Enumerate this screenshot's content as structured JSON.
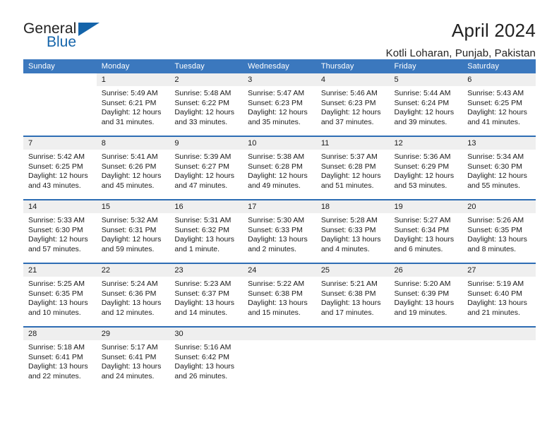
{
  "brand": {
    "line1": "General",
    "line2": "Blue",
    "mark": "triangle-icon"
  },
  "header": {
    "title": "April 2024",
    "subtitle": "Kotli Loharan, Punjab, Pakistan"
  },
  "colors": {
    "header_blue": "#3b78be",
    "row_rule_blue": "#2e6db4",
    "daynum_band": "#efefef",
    "brand_blue": "#1464aa",
    "text": "#1a1a1a"
  },
  "weekday_headers": [
    "Sunday",
    "Monday",
    "Tuesday",
    "Wednesday",
    "Thursday",
    "Friday",
    "Saturday"
  ],
  "weeks": [
    [
      {
        "day": "",
        "lines": []
      },
      {
        "day": "1",
        "lines": [
          "Sunrise: 5:49 AM",
          "Sunset: 6:21 PM",
          "Daylight: 12 hours",
          "and 31 minutes."
        ]
      },
      {
        "day": "2",
        "lines": [
          "Sunrise: 5:48 AM",
          "Sunset: 6:22 PM",
          "Daylight: 12 hours",
          "and 33 minutes."
        ]
      },
      {
        "day": "3",
        "lines": [
          "Sunrise: 5:47 AM",
          "Sunset: 6:23 PM",
          "Daylight: 12 hours",
          "and 35 minutes."
        ]
      },
      {
        "day": "4",
        "lines": [
          "Sunrise: 5:46 AM",
          "Sunset: 6:23 PM",
          "Daylight: 12 hours",
          "and 37 minutes."
        ]
      },
      {
        "day": "5",
        "lines": [
          "Sunrise: 5:44 AM",
          "Sunset: 6:24 PM",
          "Daylight: 12 hours",
          "and 39 minutes."
        ]
      },
      {
        "day": "6",
        "lines": [
          "Sunrise: 5:43 AM",
          "Sunset: 6:25 PM",
          "Daylight: 12 hours",
          "and 41 minutes."
        ]
      }
    ],
    [
      {
        "day": "7",
        "lines": [
          "Sunrise: 5:42 AM",
          "Sunset: 6:25 PM",
          "Daylight: 12 hours",
          "and 43 minutes."
        ]
      },
      {
        "day": "8",
        "lines": [
          "Sunrise: 5:41 AM",
          "Sunset: 6:26 PM",
          "Daylight: 12 hours",
          "and 45 minutes."
        ]
      },
      {
        "day": "9",
        "lines": [
          "Sunrise: 5:39 AM",
          "Sunset: 6:27 PM",
          "Daylight: 12 hours",
          "and 47 minutes."
        ]
      },
      {
        "day": "10",
        "lines": [
          "Sunrise: 5:38 AM",
          "Sunset: 6:28 PM",
          "Daylight: 12 hours",
          "and 49 minutes."
        ]
      },
      {
        "day": "11",
        "lines": [
          "Sunrise: 5:37 AM",
          "Sunset: 6:28 PM",
          "Daylight: 12 hours",
          "and 51 minutes."
        ]
      },
      {
        "day": "12",
        "lines": [
          "Sunrise: 5:36 AM",
          "Sunset: 6:29 PM",
          "Daylight: 12 hours",
          "and 53 minutes."
        ]
      },
      {
        "day": "13",
        "lines": [
          "Sunrise: 5:34 AM",
          "Sunset: 6:30 PM",
          "Daylight: 12 hours",
          "and 55 minutes."
        ]
      }
    ],
    [
      {
        "day": "14",
        "lines": [
          "Sunrise: 5:33 AM",
          "Sunset: 6:30 PM",
          "Daylight: 12 hours",
          "and 57 minutes."
        ]
      },
      {
        "day": "15",
        "lines": [
          "Sunrise: 5:32 AM",
          "Sunset: 6:31 PM",
          "Daylight: 12 hours",
          "and 59 minutes."
        ]
      },
      {
        "day": "16",
        "lines": [
          "Sunrise: 5:31 AM",
          "Sunset: 6:32 PM",
          "Daylight: 13 hours",
          "and 1 minute."
        ]
      },
      {
        "day": "17",
        "lines": [
          "Sunrise: 5:30 AM",
          "Sunset: 6:33 PM",
          "Daylight: 13 hours",
          "and 2 minutes."
        ]
      },
      {
        "day": "18",
        "lines": [
          "Sunrise: 5:28 AM",
          "Sunset: 6:33 PM",
          "Daylight: 13 hours",
          "and 4 minutes."
        ]
      },
      {
        "day": "19",
        "lines": [
          "Sunrise: 5:27 AM",
          "Sunset: 6:34 PM",
          "Daylight: 13 hours",
          "and 6 minutes."
        ]
      },
      {
        "day": "20",
        "lines": [
          "Sunrise: 5:26 AM",
          "Sunset: 6:35 PM",
          "Daylight: 13 hours",
          "and 8 minutes."
        ]
      }
    ],
    [
      {
        "day": "21",
        "lines": [
          "Sunrise: 5:25 AM",
          "Sunset: 6:35 PM",
          "Daylight: 13 hours",
          "and 10 minutes."
        ]
      },
      {
        "day": "22",
        "lines": [
          "Sunrise: 5:24 AM",
          "Sunset: 6:36 PM",
          "Daylight: 13 hours",
          "and 12 minutes."
        ]
      },
      {
        "day": "23",
        "lines": [
          "Sunrise: 5:23 AM",
          "Sunset: 6:37 PM",
          "Daylight: 13 hours",
          "and 14 minutes."
        ]
      },
      {
        "day": "24",
        "lines": [
          "Sunrise: 5:22 AM",
          "Sunset: 6:38 PM",
          "Daylight: 13 hours",
          "and 15 minutes."
        ]
      },
      {
        "day": "25",
        "lines": [
          "Sunrise: 5:21 AM",
          "Sunset: 6:38 PM",
          "Daylight: 13 hours",
          "and 17 minutes."
        ]
      },
      {
        "day": "26",
        "lines": [
          "Sunrise: 5:20 AM",
          "Sunset: 6:39 PM",
          "Daylight: 13 hours",
          "and 19 minutes."
        ]
      },
      {
        "day": "27",
        "lines": [
          "Sunrise: 5:19 AM",
          "Sunset: 6:40 PM",
          "Daylight: 13 hours",
          "and 21 minutes."
        ]
      }
    ],
    [
      {
        "day": "28",
        "lines": [
          "Sunrise: 5:18 AM",
          "Sunset: 6:41 PM",
          "Daylight: 13 hours",
          "and 22 minutes."
        ]
      },
      {
        "day": "29",
        "lines": [
          "Sunrise: 5:17 AM",
          "Sunset: 6:41 PM",
          "Daylight: 13 hours",
          "and 24 minutes."
        ]
      },
      {
        "day": "30",
        "lines": [
          "Sunrise: 5:16 AM",
          "Sunset: 6:42 PM",
          "Daylight: 13 hours",
          "and 26 minutes."
        ]
      },
      {
        "day": "",
        "lines": []
      },
      {
        "day": "",
        "lines": []
      },
      {
        "day": "",
        "lines": []
      },
      {
        "day": "",
        "lines": []
      }
    ]
  ]
}
